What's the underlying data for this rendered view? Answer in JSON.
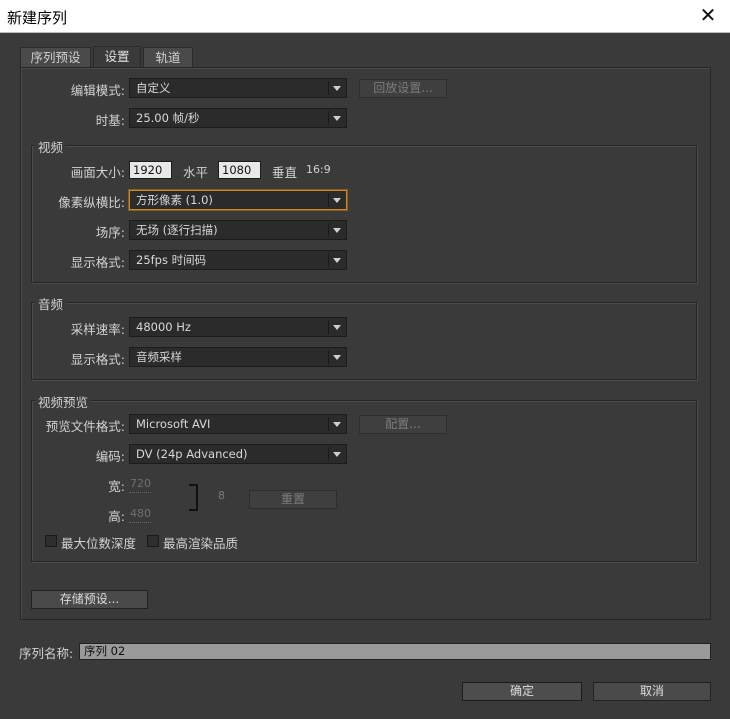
{
  "window": {
    "title": "新建序列",
    "close_glyph": "✕"
  },
  "tabs": [
    {
      "label": "序列预设"
    },
    {
      "label": "设置"
    },
    {
      "label": "轨道"
    }
  ],
  "editing_mode": {
    "label": "编辑模式:",
    "value": "自定义",
    "playback_button": "回放设置..."
  },
  "timebase": {
    "label": "时基:",
    "value": "25.00 帧/秒"
  },
  "video": {
    "group_title": "视频",
    "frame_size_label": "画面大小:",
    "width": "1920",
    "horizontal_label": "水平",
    "height": "1080",
    "vertical_label": "垂直",
    "aspect": "16:9",
    "pixel_aspect_label": "像素纵横比:",
    "pixel_aspect_value": "方形像素 (1.0)",
    "fields_label": "场序:",
    "fields_value": "无场 (逐行扫描)",
    "display_format_label": "显示格式:",
    "display_format_value": "25fps 时间码"
  },
  "audio": {
    "group_title": "音频",
    "sample_rate_label": "采样速率:",
    "sample_rate_value": "48000 Hz",
    "display_format_label": "显示格式:",
    "display_format_value": "音频采样"
  },
  "video_preview": {
    "group_title": "视频预览",
    "file_format_label": "预览文件格式:",
    "file_format_value": "Microsoft AVI",
    "configure_button": "配置...",
    "codec_label": "编码:",
    "codec_value": "DV (24p Advanced)",
    "width_label": "宽:",
    "width_value": "720",
    "height_label": "高:",
    "height_value": "480",
    "reset_button": "重置",
    "max_bit_depth_label": "最大位数深度",
    "max_render_quality_label": "最高渲染品质"
  },
  "save_preset_button": "存储预设...",
  "sequence_name": {
    "label": "序列名称:",
    "value": "序列 02"
  },
  "footer": {
    "ok": "确定",
    "cancel": "取消"
  }
}
